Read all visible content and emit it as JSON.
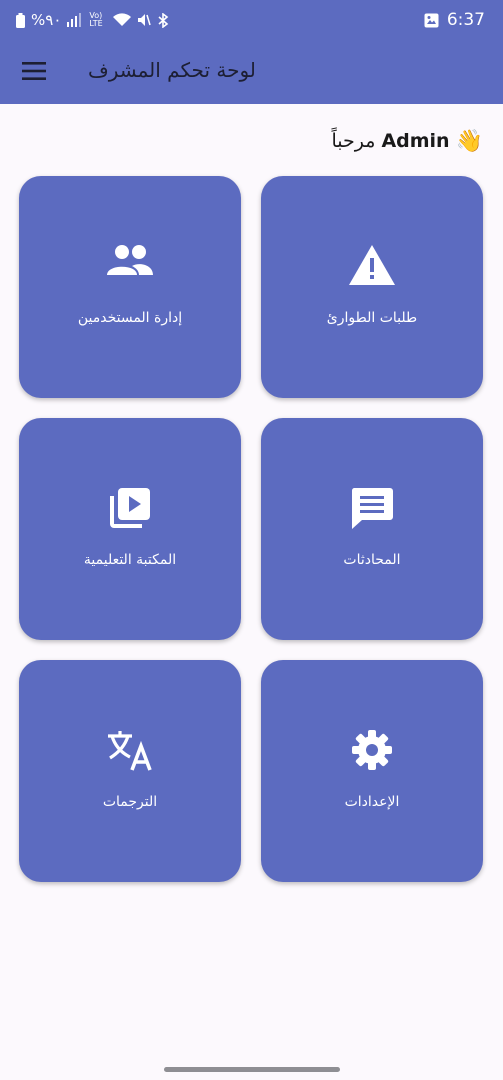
{
  "status_bar": {
    "battery": "%٩٠",
    "network": "Vo) LTE",
    "time": "6:37"
  },
  "appbar": {
    "title": "لوحة تحكم المشرف"
  },
  "welcome": {
    "greeting": "مرحباً",
    "name": "Admin",
    "emoji": "👋"
  },
  "tiles": [
    {
      "label": "طلبات الطوارئ",
      "icon": "warning-icon"
    },
    {
      "label": "إدارة المستخدمين",
      "icon": "people-icon"
    },
    {
      "label": "المحادثات",
      "icon": "chat-icon"
    },
    {
      "label": "المكتبة التعليمية",
      "icon": "video-library-icon"
    },
    {
      "label": "الإعدادات",
      "icon": "gear-icon"
    },
    {
      "label": "الترجمات",
      "icon": "translate-icon"
    }
  ],
  "colors": {
    "primary": "#5c6bc0",
    "background": "#fcf9fd",
    "on_primary": "#ffffff"
  }
}
